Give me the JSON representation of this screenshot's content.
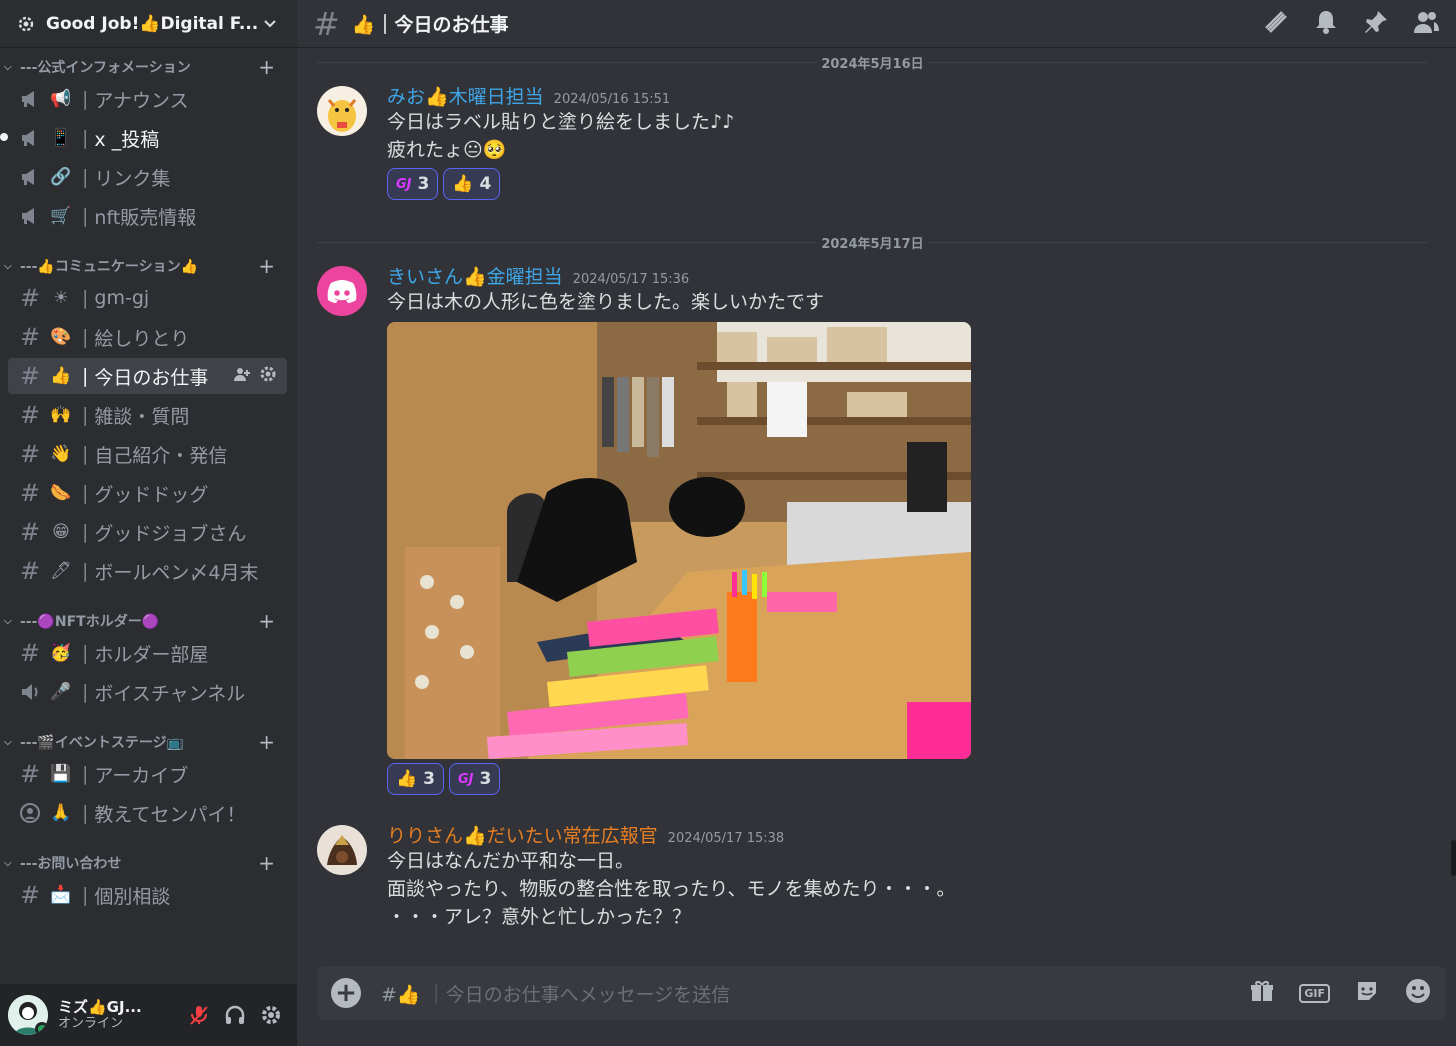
{
  "server": {
    "name": "Good Job!👍Digital F...",
    "icon": "server-settings-icon"
  },
  "categories": [
    {
      "label": "---公式インフォメーション",
      "channels": [
        {
          "icon": "announcement-icon",
          "emoji": "📢",
          "name": "アナウンス"
        },
        {
          "icon": "announcement-icon",
          "emoji": "📱",
          "name": "x _投稿"
        },
        {
          "icon": "announcement-icon",
          "emoji": "🔗",
          "name": "リンク集"
        },
        {
          "icon": "announcement-icon",
          "emoji": "🛒",
          "name": "nft販売情報"
        }
      ]
    },
    {
      "label": "---👍コミュニケーション👍",
      "channels": [
        {
          "icon": "hash-icon",
          "emoji": "☀",
          "name": "gm-gj"
        },
        {
          "icon": "hash-icon",
          "emoji": "🎨",
          "name": "絵しりとり"
        },
        {
          "icon": "hash-icon",
          "emoji": "👍",
          "name": "今日のお仕事"
        },
        {
          "icon": "hash-icon",
          "emoji": "🙌",
          "name": "雑談・質問"
        },
        {
          "icon": "hash-icon",
          "emoji": "👋",
          "name": "自己紹介・発信"
        },
        {
          "icon": "hash-icon",
          "emoji": "🌭",
          "name": "グッドドッグ"
        },
        {
          "icon": "hash-icon",
          "emoji": "😁",
          "name": "グッドジョブさん"
        },
        {
          "icon": "hash-icon",
          "emoji": "🖊",
          "name": "ボールペン〆4月末"
        }
      ]
    },
    {
      "label": "---🟣NFTホルダー🟣",
      "channels": [
        {
          "icon": "hash-icon",
          "emoji": "🥳",
          "name": "ホルダー部屋"
        },
        {
          "icon": "voice-icon",
          "emoji": "🎤",
          "name": "ボイスチャンネル"
        }
      ]
    },
    {
      "label": "---🎬イベントステージ📺",
      "channels": [
        {
          "icon": "hash-icon",
          "emoji": "💾",
          "name": "アーカイブ"
        },
        {
          "icon": "stage-icon",
          "emoji": "🙏",
          "name": "教えてセンパイ！"
        }
      ]
    },
    {
      "label": "---お問い合わせ",
      "channels": [
        {
          "icon": "hash-icon",
          "emoji": "📩",
          "name": "個別相談"
        }
      ]
    }
  ],
  "user": {
    "name": "ミズ👍GJ...",
    "status": "オンライン"
  },
  "channel": {
    "emoji": "👍",
    "title": "👍｜今日のお仕事",
    "placeholder": "｜今日のお仕事へメッセージを送信",
    "composer_prefix": "#👍"
  },
  "messages": [
    {
      "date": "2024年5月16日",
      "author": "みお👍木曜日担当",
      "color": "#3ea6e6",
      "time": "2024/05/16 15:51",
      "lines": [
        "今日はラベル貼りと塗り絵をしました♪♪",
        "疲れたょ😐🥺"
      ],
      "reactions": [
        {
          "emoji": "GJ",
          "count": "3"
        },
        {
          "emoji": "👍",
          "count": "4"
        }
      ]
    },
    {
      "date": "2024年5月17日",
      "author": "きいさん👍金曜担当",
      "color": "#3ea6e6",
      "time": "2024/05/17 15:36",
      "lines": [
        "今日は木の人形に色を塗りました。楽しいかたです"
      ],
      "reactions": [
        {
          "emoji": "👍",
          "count": "3"
        },
        {
          "emoji": "GJ",
          "count": "3"
        }
      ]
    },
    {
      "author": "りりさん👍だいたい常在広報官",
      "color": "#e67e22",
      "time": "2024/05/17 15:38",
      "lines": [
        "今日はなんだか平和な一日。",
        "面談やったり、物販の整合性を取ったり、モノを集めたり・・・。",
        "",
        "・・・アレ？意外と忙しかった？？"
      ]
    }
  ],
  "colors": {
    "accent": "#5865f2",
    "online": "#23a55a",
    "discord_pink": "#eb459f"
  }
}
